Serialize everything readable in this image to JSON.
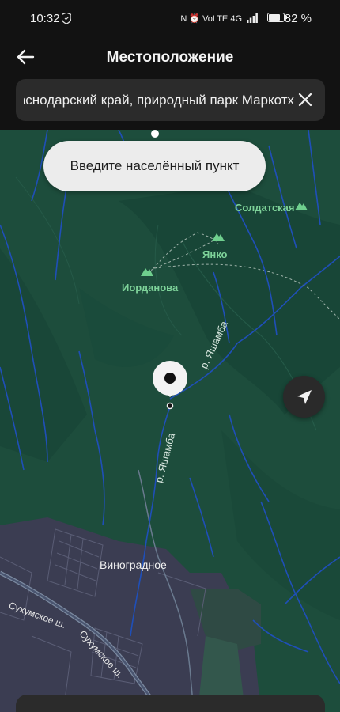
{
  "status_bar": {
    "time": "10:32",
    "network_glyphs": "N ⏰ VoLTE 4G",
    "battery_percent_text": "82 %",
    "battery_level": 0.82
  },
  "header": {
    "title": "Местоположение",
    "back_icon": "arrow-left-icon"
  },
  "search": {
    "value": "Краснодарский край, природный парк Маркотх",
    "clear_icon": "close-icon"
  },
  "tooltip": {
    "text": "Введите населённый пункт"
  },
  "map": {
    "colors": {
      "forest": "#1d4d3c",
      "forest_dark": "#163f31",
      "settlement": "#3b3d52",
      "water": "#1f4fb8",
      "peak_label": "#7ed39a"
    },
    "peaks": [
      "Солдатская",
      "Янко",
      "Иорданова"
    ],
    "rivers": [
      "р. Яшамба",
      "р. Яшамба"
    ],
    "town": "Виноградное",
    "roads": [
      "Сухумское ш.",
      "Сухумское ш."
    ],
    "locate_icon": "navigation-arrow-icon",
    "pin_icon": "map-pin-icon"
  }
}
